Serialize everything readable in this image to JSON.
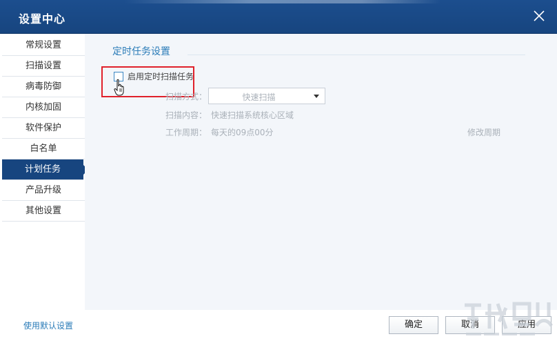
{
  "window": {
    "title": "设置中心"
  },
  "sidebar": {
    "items": [
      {
        "label": "常规设置"
      },
      {
        "label": "扫描设置"
      },
      {
        "label": "病毒防御"
      },
      {
        "label": "内核加固"
      },
      {
        "label": "软件保护"
      },
      {
        "label": "白名单"
      },
      {
        "label": "计划任务",
        "active": true
      },
      {
        "label": "产品升级"
      },
      {
        "label": "其他设置"
      }
    ]
  },
  "main": {
    "section_title": "定时任务设置",
    "enable_checkbox": {
      "label": "启用定时扫描任务",
      "checked": false
    },
    "scan_mode": {
      "label": "扫描方式：",
      "value": "快速扫描"
    },
    "scan_content": {
      "label": "扫描内容：",
      "value": "快速扫描系统核心区域"
    },
    "work_cycle": {
      "label": "工作周期：",
      "value": "每天的09点00分",
      "modify_label": "修改周期"
    }
  },
  "footer": {
    "default_link": "使用默认设置",
    "ok_label": "确定",
    "cancel_label": "取消",
    "apply_label": "应用"
  },
  "colors": {
    "titlebar": "#17457f",
    "accent": "#2b7cb8",
    "highlight": "#e0202a"
  }
}
